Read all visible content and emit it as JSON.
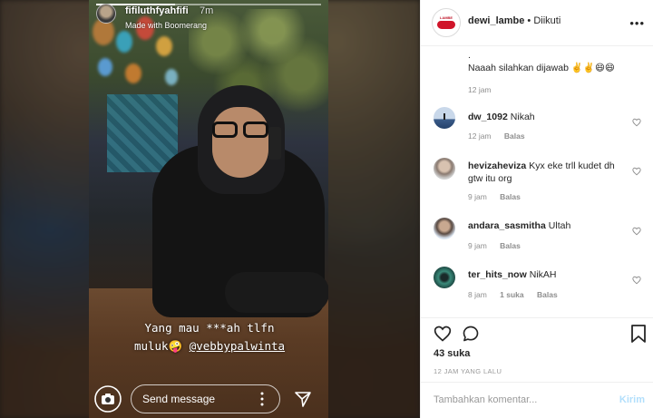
{
  "story": {
    "username": "fifiluthfyahfifi",
    "time": "7m",
    "subtitle": "Made with Boomerang",
    "caption_line1": "Yang mau ***ah tlfn",
    "caption_line2_prefix": "muluk🤪",
    "caption_mention": "@vebbypalwinta",
    "reply_placeholder": "Send message",
    "progress": 0.35
  },
  "post": {
    "account": "dewi_lambe",
    "separator": "•",
    "follow_status": "Diikuti",
    "more": "•••"
  },
  "comments": [
    {
      "user": "",
      "text_dot": ".",
      "text": "Naaah silahkan dijawab ✌️✌️😄😄",
      "time": "12 jam",
      "reply": "",
      "likes": ""
    },
    {
      "user": "dw_1092",
      "text": "Nikah",
      "time": "12 jam",
      "reply": "Balas",
      "likes": ""
    },
    {
      "user": "hevizaheviza",
      "text": "Kyx eke trll kudet dh gtw itu org",
      "time": "9 jam",
      "reply": "Balas",
      "likes": ""
    },
    {
      "user": "andara_sasmitha",
      "text": "Ultah",
      "time": "9 jam",
      "reply": "Balas",
      "likes": ""
    },
    {
      "user": "ter_hits_now",
      "text": "NikAH",
      "time": "8 jam",
      "reply": "Balas",
      "likes": "1 suka"
    }
  ],
  "actions": {
    "likes": "43 suka",
    "date": "12 JAM YANG LALU"
  },
  "composer": {
    "placeholder": "Tambahkan komentar...",
    "post_label": "Kirim"
  },
  "colors": {
    "link_disabled": "#b2dffc",
    "meta_gray": "#8e8e8e",
    "brand_red": "#d0152a"
  }
}
